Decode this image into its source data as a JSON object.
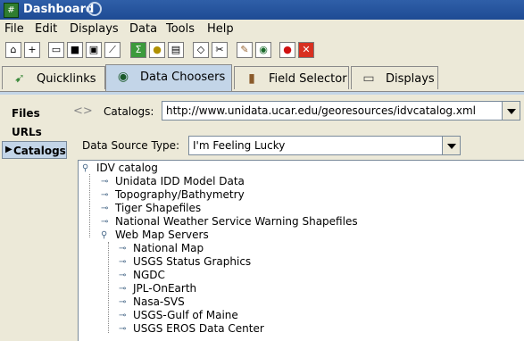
{
  "window": {
    "title": "Dashboard"
  },
  "menu": [
    "File",
    "Edit",
    "Displays",
    "Data",
    "Tools",
    "Help"
  ],
  "toolbar_icons": [
    "home-icon",
    "new-doc-icon",
    "open-folder-icon",
    "save-icon",
    "save-as-icon",
    "wizard-icon",
    "formula-icon",
    "idea-icon",
    "display-icon",
    "erase-icon",
    "cut-icon",
    "pencil-icon",
    "globe-icon",
    "stop-icon",
    "close-icon"
  ],
  "tabs": [
    {
      "label": "Quicklinks"
    },
    {
      "label": "Data Choosers"
    },
    {
      "label": "Field Selector"
    },
    {
      "label": "Displays"
    }
  ],
  "leftnav": [
    {
      "label": "Files"
    },
    {
      "label": "URLs"
    },
    {
      "label": "Catalogs"
    }
  ],
  "catalog": {
    "nav_arrows": "<>",
    "label": "Catalogs:",
    "value": "http://www.unidata.ucar.edu/georesources/idvcatalog.xml"
  },
  "data_source": {
    "label": "Data Source Type:",
    "value": "I'm Feeling Lucky"
  },
  "tree": {
    "root": "IDV catalog",
    "children": [
      "Unidata IDD Model Data",
      "Topography/Bathymetry",
      "Tiger Shapefiles",
      "National Weather Service Warning Shapefiles",
      "Web Map Servers"
    ],
    "wms_children": [
      "National Map",
      "USGS Status Graphics",
      "NGDC",
      "JPL-OnEarth",
      "Nasa-SVS",
      "USGS-Gulf of Maine",
      "USGS EROS Data Center"
    ]
  }
}
